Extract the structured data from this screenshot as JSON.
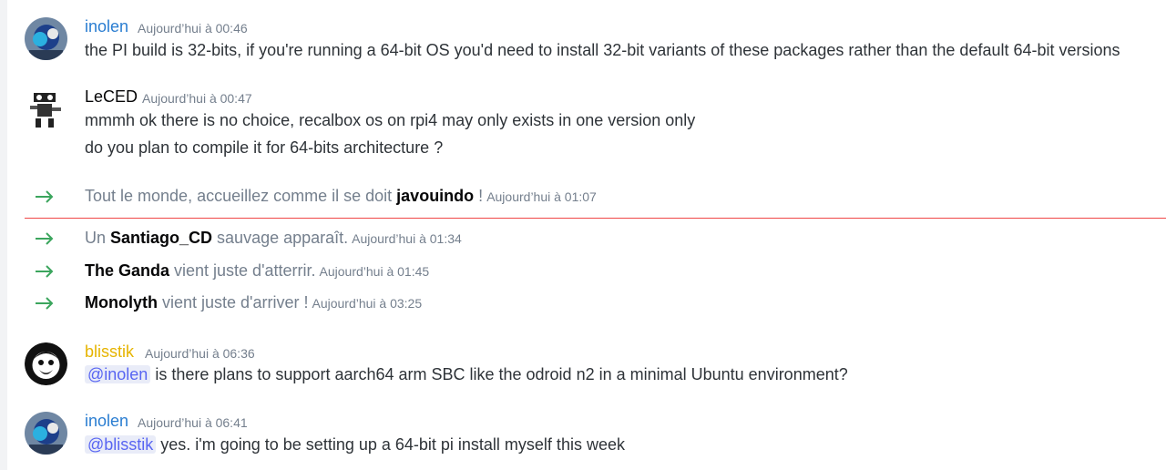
{
  "colors": {
    "link_blue": "#2a7dd1",
    "gold": "#e6b400",
    "system_arrow": "#3ba55d",
    "new_divider": "#f04747",
    "mention_bg": "#e9ecf8",
    "mention_text": "#5865f2"
  },
  "messages": [
    {
      "author": "inolen",
      "time": "Aujourd’hui à 00:46",
      "lines": [
        "the PI build is 32-bits, if you're running a 64-bit OS you'd need to install 32-bit variants of these packages rather than the default 64-bit versions"
      ]
    },
    {
      "author": "LeCED",
      "time": "Aujourd’hui à 00:47",
      "lines": [
        "mmmh ok there is no choice, recalbox os on rpi4 may only exists in one version only",
        "do you plan to compile it for 64-bits architecture ?"
      ]
    },
    {
      "author": "blisstik",
      "time": "Aujourd’hui à 06:36",
      "mention": "@inolen",
      "text": " is there plans to support aarch64 arm SBC like the odroid n2 in a minimal Ubuntu environment?"
    },
    {
      "author": "inolen",
      "time": "Aujourd’hui à 06:41",
      "mention": "@blisstik",
      "text": " yes. i'm going to be setting up a 64-bit pi install myself this week"
    }
  ],
  "system": [
    {
      "pre": "Tout le monde, accueillez comme il se doit ",
      "name": "javouindo",
      "post": " !",
      "time": "Aujourd’hui à 01:07"
    },
    {
      "pre": "Un ",
      "name": "Santiago_CD",
      "post": " sauvage apparaît.",
      "time": "Aujourd’hui à 01:34"
    },
    {
      "pre": "",
      "name": "The Ganda",
      "post": " vient juste d'atterrir.",
      "time": "Aujourd’hui à 01:45"
    },
    {
      "pre": "",
      "name": "Monolyth",
      "post": " vient juste d'arriver !",
      "time": "Aujourd’hui à 03:25"
    }
  ]
}
